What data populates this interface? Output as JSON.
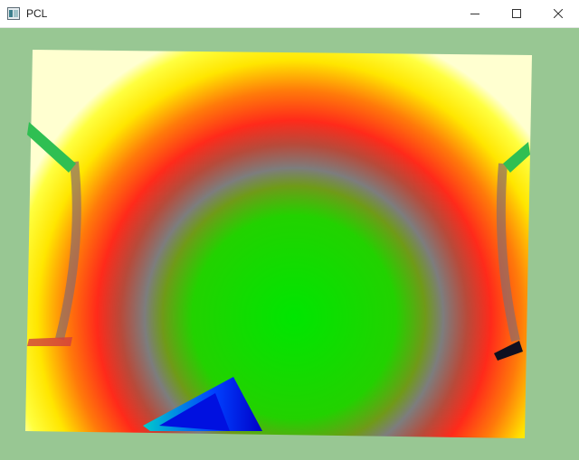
{
  "window": {
    "title": "PCL"
  },
  "icons": {
    "app": "pcl-window-icon",
    "minimize": "minimize-icon",
    "maximize": "maximize-icon",
    "close": "close-icon"
  },
  "viewer": {
    "background_color": "#98c793",
    "colormap": [
      "#ffffff",
      "#ffff00",
      "#ff2a1a",
      "#7d7d7d",
      "#00e600",
      "#00cccc",
      "#0000ff"
    ]
  }
}
